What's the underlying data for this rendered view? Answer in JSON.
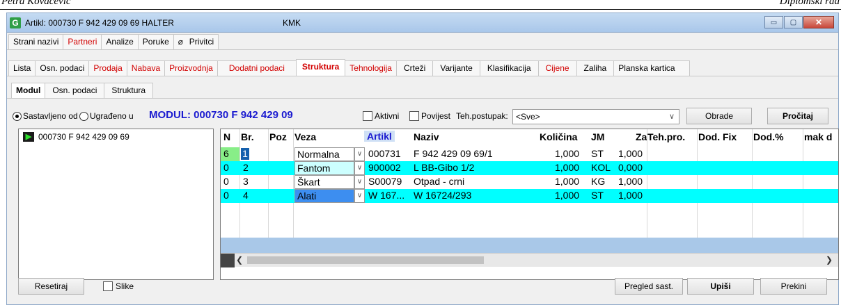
{
  "doc_header": {
    "left": "Petra Kovačević",
    "right": "Diplomski rad"
  },
  "window": {
    "title": "Artikl: 000730 F 942 429 09 69 HALTER",
    "subtitle": "KMK",
    "icon": "G",
    "buttons": {
      "minimize": "▭",
      "maximize": "▢",
      "close": "✕"
    }
  },
  "tabs_row1": [
    "Strani nazivi",
    "Partneri",
    "Analize",
    "Poruke",
    "Privitci"
  ],
  "tabs_row2": [
    "Lista",
    "Osn. podaci",
    "Prodaja",
    "Nabava",
    "Proizvodnja",
    "Dodatni podaci",
    "Struktura",
    "Tehnologija",
    "Crteži",
    "Varijante",
    "Klasifikacija",
    "Cijene",
    "Zaliha",
    "Planska kartica"
  ],
  "tabs_row3": [
    "Modul",
    "Osn. podaci",
    "Struktura"
  ],
  "options": {
    "radio1": "Sastavljeno od",
    "radio2": "Ugrađeno u",
    "modul_title": "MODUL: 000730  F 942 429 09",
    "aktivni": "Aktivni",
    "povijest": "Povijest",
    "teh_postupak_label": "Teh.postupak:",
    "teh_postupak_value": "<Sve>",
    "obrade": "Obrade",
    "procitaj": "Pročitaj"
  },
  "tree": {
    "item": "000730  F 942 429 09 69"
  },
  "grid": {
    "headers": [
      "N",
      "Br.",
      "Poz",
      "Veza",
      "Artikl",
      "Naziv",
      "Količina",
      "JM",
      "Za",
      "Teh.pro.",
      "Dod. Fix",
      "Dod.%",
      "mak d"
    ],
    "rows": [
      {
        "n": "6",
        "br": "1",
        "veza": "Normalna",
        "artikl": "000731",
        "naziv": "F 942 429 09 69/1",
        "kolicina": "1,000",
        "jm": "ST",
        "za": "1,000"
      },
      {
        "n": "0",
        "br": "2",
        "veza": "Fantom",
        "artikl": "900002",
        "naziv": "L BB-Gibo 1/2",
        "kolicina": "1,000",
        "jm": "KOL",
        "za": "0,000"
      },
      {
        "n": "0",
        "br": "3",
        "veza": "Škart",
        "artikl": "S00079",
        "naziv": "Otpad - crni",
        "kolicina": "1,000",
        "jm": "KG",
        "za": "1,000"
      },
      {
        "n": "0",
        "br": "4",
        "veza": "Alati",
        "artikl": "W 167...",
        "naziv": "W 16724/293",
        "kolicina": "1,000",
        "jm": "ST",
        "za": "1,000"
      }
    ]
  },
  "footer": {
    "resetiraj": "Resetiraj",
    "slike": "Slike",
    "pregled": "Pregled sast.",
    "upisi": "Upiši",
    "prekini": "Prekini"
  }
}
